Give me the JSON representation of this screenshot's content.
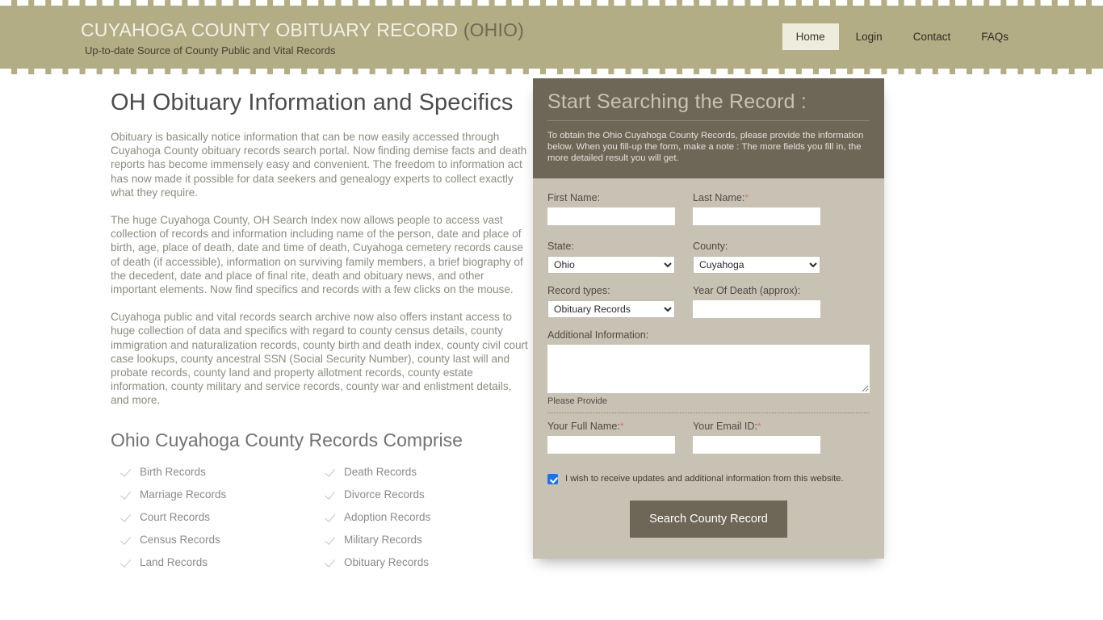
{
  "header": {
    "brand_title_main": "CUYAHOGA COUNTY OBITUARY RECORD ",
    "brand_title_state": "(OHIO)",
    "brand_subtitle": "Up-to-date Source of  County Public and Vital Records",
    "nav": [
      {
        "label": "Home",
        "active": true
      },
      {
        "label": "Login",
        "active": false
      },
      {
        "label": "Contact",
        "active": false
      },
      {
        "label": "FAQs",
        "active": false
      }
    ]
  },
  "main": {
    "heading": "OH Obituary Information and Specifics",
    "paragraphs": [
      "Obituary is basically notice information that can be now easily accessed through Cuyahoga County obituary records search portal. Now finding demise facts and death reports has become immensely easy and convenient. The freedom to information act has now made it possible for data seekers and genealogy experts to collect exactly what they require.",
      "The huge Cuyahoga County, OH Search Index now allows people to access vast collection of records and information including name of the person, date and place of birth, age, place of death, date and time of death, Cuyahoga cemetery records cause of death (if accessible), information on surviving family members, a brief biography of the decedent, date and place of final rite, death and obituary news, and other important elements. Now find specifics and records with a few clicks on the mouse.",
      "Cuyahoga public and vital records search archive now also offers instant access to huge collection of data and specifics with regard to county census details, county immigration and naturalization records, county birth and death index, county civil court case lookups, county ancestral SSN (Social Security Number), county last will and probate records, county land and property allotment records, county estate information, county military and service records, county war and enlistment details, and more."
    ],
    "records_heading": "Ohio Cuyahoga County Records Comprise",
    "records": [
      "Birth Records",
      "Death Records",
      "Marriage Records",
      "Divorce Records",
      "Court Records",
      "Adoption Records",
      "Census Records",
      "Military Records",
      "Land Records",
      "Obituary Records"
    ]
  },
  "search_panel": {
    "title": "Start Searching the Record :",
    "intro": "To obtain the Ohio Cuyahoga County Records, please provide the information below. When you fill-up the form, make a note : The more fields you fill in, the more detailed result you will get.",
    "first_name_label": "First Name:",
    "first_name_value": "",
    "last_name_label": "Last Name:",
    "last_name_required": "*",
    "last_name_value": "",
    "state_label": "State:",
    "state_value": "Ohio",
    "county_label": "County:",
    "county_value": "Cuyahoga",
    "record_types_label": "Record types:",
    "record_types_value": "Obituary Records",
    "year_of_death_label": "Year Of Death (approx):",
    "year_of_death_value": "",
    "additional_info_label": "Additional Information:",
    "additional_info_value": "",
    "additional_info_hint": "Please Provide",
    "full_name_label": "Your Full Name:",
    "full_name_required": "*",
    "full_name_value": "",
    "email_label": "Your Email ID:",
    "email_required": "*",
    "email_value": "",
    "consent_text": "I wish to receive updates and additional information from this website.",
    "submit_label": "Search County Record",
    "accent_color": "#6e6758",
    "panel_body_color": "#c8c2b5",
    "checkbox_color": "#1a73e8"
  }
}
